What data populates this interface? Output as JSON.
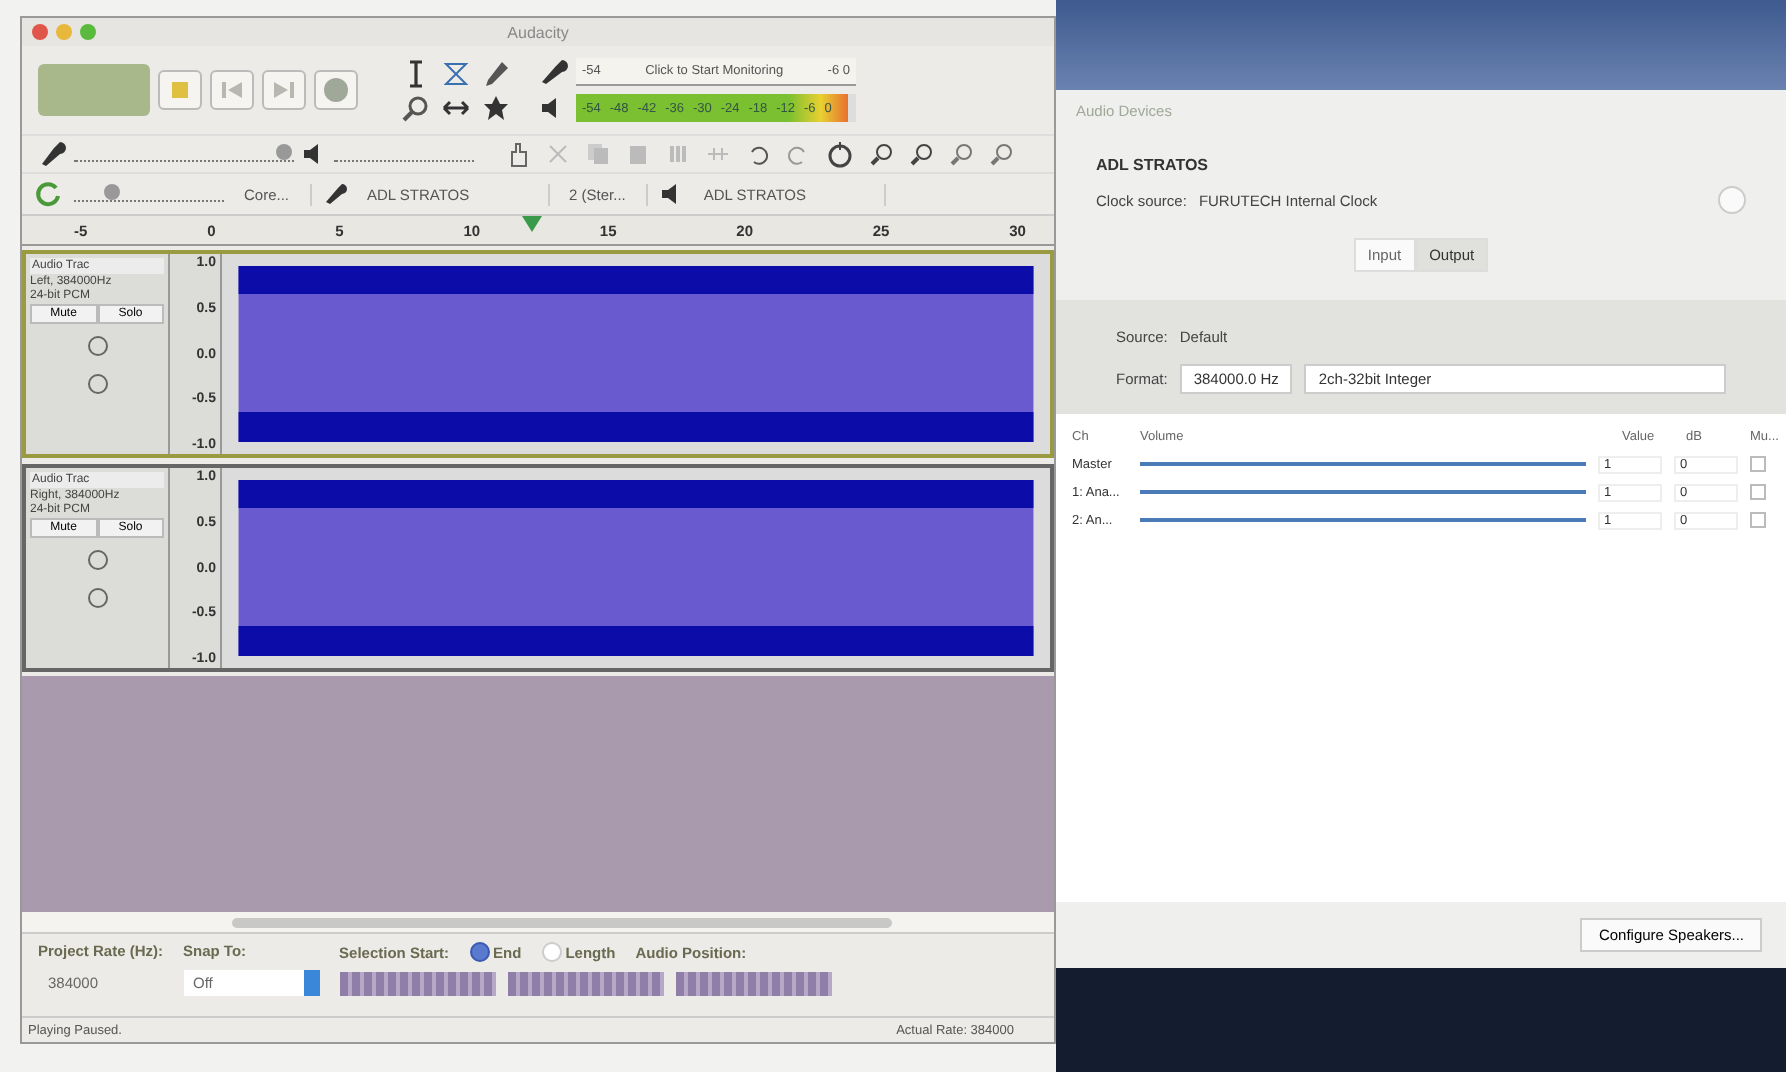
{
  "audacity": {
    "title": "Audacity",
    "record_meter": {
      "low": "-54",
      "label": "Click to Start Monitoring",
      "high": "-6 0"
    },
    "playback_meter": {
      "ticks": [
        "-54",
        "-48",
        "-42",
        "-36",
        "-30",
        "-24",
        "-18",
        "-12",
        "-6",
        "0"
      ],
      "level": 0.97
    },
    "recording_volume": {
      "level": 0.92
    },
    "play_speed": {
      "level": 0.2
    },
    "devices": {
      "host": "Core...",
      "input": "ADL STRATOS",
      "channels": "2 (Ster...",
      "output": "ADL STRATOS"
    },
    "ruler": [
      "-5",
      "0",
      "5",
      "10",
      "15",
      "20",
      "25",
      "30"
    ],
    "tracks": [
      {
        "name": "Audio Trac",
        "info": "Left, 384000Hz",
        "format": "24-bit PCM",
        "mute": "Mute",
        "solo": "Solo",
        "selected": true,
        "scale": [
          "1.0",
          "0.5",
          "0.0",
          "-0.5",
          "-1.0"
        ]
      },
      {
        "name": "Audio Trac",
        "info": "Right, 384000Hz",
        "format": "24-bit PCM",
        "mute": "Mute",
        "solo": "Solo",
        "selected": false,
        "scale": [
          "1.0",
          "0.5",
          "0.0",
          "-0.5",
          "-1.0"
        ]
      }
    ],
    "selection_bar": {
      "rate_label": "Project Rate (Hz):",
      "rate": "384000",
      "snap_label": "Snap To:",
      "snap": "Off",
      "start_label": "Selection Start:",
      "modes": [
        {
          "label": "End",
          "selected": true
        },
        {
          "label": "Length",
          "selected": false
        }
      ],
      "position_label": "Audio Position:"
    },
    "status": {
      "left": "Playing Paused.",
      "right": "Actual Rate: 384000"
    }
  },
  "audio_devices": {
    "title": "Audio Devices",
    "device": "ADL STRATOS",
    "clock_label": "Clock source:",
    "clock": "FURUTECH Internal Clock",
    "tabs": [
      {
        "label": "Input",
        "selected": false
      },
      {
        "label": "Output",
        "selected": true
      }
    ],
    "source_label": "Source:",
    "source": "Default",
    "format_label": "Format:",
    "rate": "384000.0 Hz",
    "format": "2ch-32bit Integer",
    "columns": [
      "Ch",
      "Volume",
      "Value",
      "dB",
      "Mu..."
    ],
    "channels": [
      {
        "name": "Master",
        "level": 1,
        "value": "1",
        "db": "0",
        "muted": false
      },
      {
        "name": "1: Ana...",
        "level": 1,
        "value": "1",
        "db": "0",
        "muted": false
      },
      {
        "name": "2: An...",
        "level": 1,
        "value": "1",
        "db": "0",
        "muted": false
      }
    ],
    "button": "Configure Speakers..."
  }
}
